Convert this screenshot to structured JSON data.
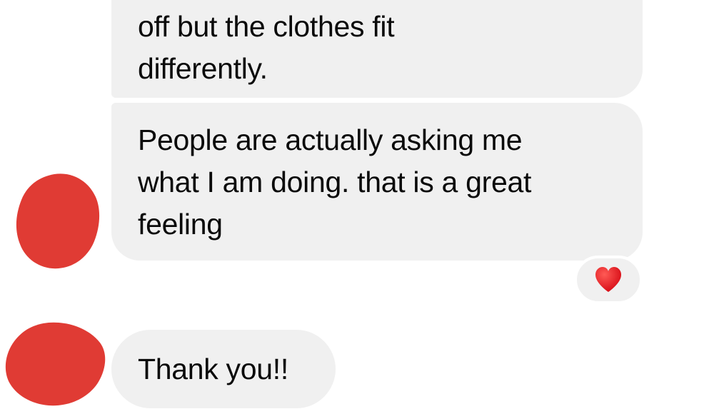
{
  "conversation": {
    "messages": [
      {
        "sender": "other",
        "lines": [
          "off but the clothes fit",
          "differently."
        ]
      },
      {
        "sender": "other",
        "lines": [
          "People are actually asking me",
          "what I am doing. that is a great",
          "feeling"
        ],
        "reaction": "heart-icon"
      },
      {
        "sender": "other",
        "lines": [
          "Thank you!!"
        ]
      }
    ],
    "avatar_redaction_color": "#e03b34",
    "bubble_color": "#f0f0f0",
    "heart_color": "#e8141c"
  }
}
